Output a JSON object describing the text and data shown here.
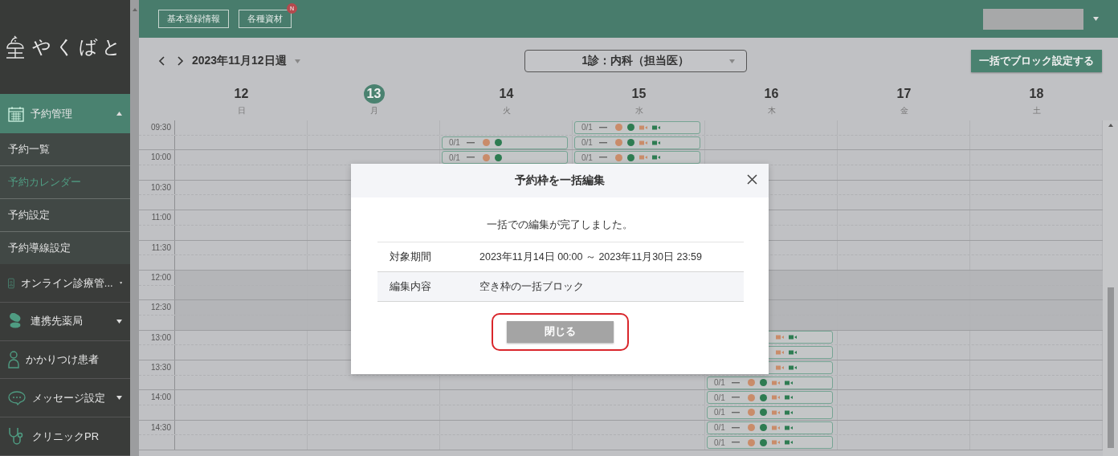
{
  "sidebar": {
    "logo": "やくばと",
    "groups": [
      {
        "label": "予約管理",
        "kind": "menu",
        "selected": true,
        "expanded": true,
        "children": [
          {
            "label": "予約一覧",
            "selected": false
          },
          {
            "label": "予約カレンダー",
            "selected": true
          },
          {
            "label": "予約設定",
            "selected": false
          },
          {
            "label": "予約導線設定",
            "selected": false
          }
        ]
      },
      {
        "label": "オンライン診療管...",
        "kind": "menu",
        "selected": false,
        "expanded": false
      },
      {
        "label": "連携先薬局",
        "kind": "menu",
        "selected": false,
        "expanded": false
      },
      {
        "label": "かかりつけ患者",
        "kind": "link",
        "selected": false
      },
      {
        "label": "メッセージ設定",
        "kind": "menu",
        "selected": false,
        "expanded": false
      },
      {
        "label": "クリニックPR",
        "kind": "link",
        "selected": false
      }
    ]
  },
  "topbar": {
    "buttons": [
      {
        "label": "基本登録情報"
      },
      {
        "label": "各種資材",
        "badge": "N"
      }
    ]
  },
  "toolbar": {
    "week": "2023年11月12日週",
    "department": "1診：内科（担当医）",
    "block_button": "一括でブロック設定する"
  },
  "days": [
    {
      "date": "12",
      "weekday": "日",
      "today": false
    },
    {
      "date": "13",
      "weekday": "月",
      "today": true
    },
    {
      "date": "14",
      "weekday": "火",
      "today": false
    },
    {
      "date": "15",
      "weekday": "水",
      "today": false
    },
    {
      "date": "16",
      "weekday": "木",
      "today": false
    },
    {
      "date": "17",
      "weekday": "金",
      "today": false
    },
    {
      "date": "18",
      "weekday": "土",
      "today": false
    }
  ],
  "rows": [
    {
      "time": "09:30",
      "shaded": false,
      "cells": [
        {
          "kind": "empty"
        },
        {
          "kind": "empty"
        },
        {
          "kind": "empty"
        },
        {
          "kind": "full",
          "count": "0/1"
        },
        {
          "kind": "empty"
        },
        {
          "kind": "empty"
        },
        {
          "kind": "empty"
        }
      ]
    },
    {
      "shaded": false,
      "cells": [
        {
          "kind": "empty"
        },
        {
          "kind": "empty"
        },
        {
          "kind": "dots",
          "count": "0/1"
        },
        {
          "kind": "full",
          "count": "0/1"
        },
        {
          "kind": "empty"
        },
        {
          "kind": "empty"
        },
        {
          "kind": "empty"
        }
      ]
    },
    {
      "time": "10:00",
      "shaded": false,
      "cells": [
        {
          "kind": "empty"
        },
        {
          "kind": "empty"
        },
        {
          "kind": "dots",
          "count": "0/1"
        },
        {
          "kind": "full",
          "count": "0/1"
        },
        {
          "kind": "empty"
        },
        {
          "kind": "empty"
        },
        {
          "kind": "empty"
        }
      ]
    },
    {
      "shaded": false,
      "cells": [
        {
          "kind": "empty"
        },
        {
          "kind": "empty"
        },
        {
          "kind": "empty"
        },
        {
          "kind": "empty"
        },
        {
          "kind": "empty"
        },
        {
          "kind": "empty"
        },
        {
          "kind": "empty"
        }
      ]
    },
    {
      "time": "10:30",
      "shaded": false,
      "cells": [
        {
          "kind": "empty"
        },
        {
          "kind": "empty"
        },
        {
          "kind": "empty"
        },
        {
          "kind": "empty"
        },
        {
          "kind": "empty"
        },
        {
          "kind": "empty"
        },
        {
          "kind": "empty"
        }
      ]
    },
    {
      "shaded": false,
      "cells": [
        {
          "kind": "empty"
        },
        {
          "kind": "empty"
        },
        {
          "kind": "empty"
        },
        {
          "kind": "empty"
        },
        {
          "kind": "empty"
        },
        {
          "kind": "empty"
        },
        {
          "kind": "empty"
        }
      ]
    },
    {
      "time": "11:00",
      "shaded": false,
      "cells": [
        {
          "kind": "empty"
        },
        {
          "kind": "empty"
        },
        {
          "kind": "empty"
        },
        {
          "kind": "empty"
        },
        {
          "kind": "empty"
        },
        {
          "kind": "empty"
        },
        {
          "kind": "empty"
        }
      ]
    },
    {
      "shaded": false,
      "cells": [
        {
          "kind": "empty"
        },
        {
          "kind": "empty"
        },
        {
          "kind": "empty"
        },
        {
          "kind": "empty"
        },
        {
          "kind": "empty"
        },
        {
          "kind": "empty"
        },
        {
          "kind": "empty"
        }
      ]
    },
    {
      "time": "11:30",
      "shaded": false,
      "cells": [
        {
          "kind": "empty"
        },
        {
          "kind": "empty"
        },
        {
          "kind": "empty"
        },
        {
          "kind": "empty"
        },
        {
          "kind": "empty"
        },
        {
          "kind": "empty"
        },
        {
          "kind": "empty"
        }
      ]
    },
    {
      "shaded": false,
      "cells": [
        {
          "kind": "empty"
        },
        {
          "kind": "empty"
        },
        {
          "kind": "empty"
        },
        {
          "kind": "empty"
        },
        {
          "kind": "empty"
        },
        {
          "kind": "empty"
        },
        {
          "kind": "empty"
        }
      ]
    },
    {
      "time": "12:00",
      "shaded": true,
      "cells": [
        {
          "kind": "empty"
        },
        {
          "kind": "empty"
        },
        {
          "kind": "empty"
        },
        {
          "kind": "empty"
        },
        {
          "kind": "empty"
        },
        {
          "kind": "empty"
        },
        {
          "kind": "empty"
        }
      ]
    },
    {
      "shaded": true,
      "cells": [
        {
          "kind": "empty"
        },
        {
          "kind": "empty"
        },
        {
          "kind": "empty"
        },
        {
          "kind": "empty"
        },
        {
          "kind": "empty"
        },
        {
          "kind": "empty"
        },
        {
          "kind": "empty"
        }
      ]
    },
    {
      "time": "12:30",
      "shaded": true,
      "cells": [
        {
          "kind": "empty"
        },
        {
          "kind": "empty"
        },
        {
          "kind": "empty"
        },
        {
          "kind": "empty"
        },
        {
          "kind": "empty"
        },
        {
          "kind": "empty"
        },
        {
          "kind": "empty"
        }
      ]
    },
    {
      "shaded": true,
      "cells": [
        {
          "kind": "empty"
        },
        {
          "kind": "empty"
        },
        {
          "kind": "empty"
        },
        {
          "kind": "empty"
        },
        {
          "kind": "empty"
        },
        {
          "kind": "empty"
        },
        {
          "kind": "empty"
        }
      ]
    },
    {
      "time": "13:00",
      "shaded": false,
      "cells": [
        {
          "kind": "empty"
        },
        {
          "kind": "empty"
        },
        {
          "kind": "empty"
        },
        {
          "kind": "empty"
        },
        {
          "kind": "cams"
        },
        {
          "kind": "empty"
        },
        {
          "kind": "empty"
        }
      ]
    },
    {
      "shaded": false,
      "cells": [
        {
          "kind": "empty"
        },
        {
          "kind": "empty"
        },
        {
          "kind": "empty"
        },
        {
          "kind": "empty"
        },
        {
          "kind": "cams"
        },
        {
          "kind": "empty"
        },
        {
          "kind": "empty"
        }
      ]
    },
    {
      "time": "13:30",
      "shaded": false,
      "cells": [
        {
          "kind": "empty"
        },
        {
          "kind": "empty"
        },
        {
          "kind": "empty"
        },
        {
          "kind": "empty"
        },
        {
          "kind": "cams"
        },
        {
          "kind": "empty"
        },
        {
          "kind": "empty"
        }
      ]
    },
    {
      "shaded": false,
      "cells": [
        {
          "kind": "empty"
        },
        {
          "kind": "empty"
        },
        {
          "kind": "empty"
        },
        {
          "kind": "empty"
        },
        {
          "kind": "full",
          "count": "0/1"
        },
        {
          "kind": "empty"
        },
        {
          "kind": "empty"
        }
      ]
    },
    {
      "time": "14:00",
      "shaded": false,
      "cells": [
        {
          "kind": "empty"
        },
        {
          "kind": "empty"
        },
        {
          "kind": "empty"
        },
        {
          "kind": "empty"
        },
        {
          "kind": "full",
          "count": "0/1"
        },
        {
          "kind": "empty"
        },
        {
          "kind": "empty"
        }
      ]
    },
    {
      "shaded": false,
      "cells": [
        {
          "kind": "empty"
        },
        {
          "kind": "empty"
        },
        {
          "kind": "empty"
        },
        {
          "kind": "empty"
        },
        {
          "kind": "full",
          "count": "0/1"
        },
        {
          "kind": "empty"
        },
        {
          "kind": "empty"
        }
      ]
    },
    {
      "time": "14:30",
      "shaded": false,
      "cells": [
        {
          "kind": "empty"
        },
        {
          "kind": "empty"
        },
        {
          "kind": "empty"
        },
        {
          "kind": "empty"
        },
        {
          "kind": "full",
          "count": "0/1"
        },
        {
          "kind": "empty"
        },
        {
          "kind": "empty"
        }
      ]
    },
    {
      "shaded": false,
      "cells": [
        {
          "kind": "empty"
        },
        {
          "kind": "empty"
        },
        {
          "kind": "empty"
        },
        {
          "kind": "empty"
        },
        {
          "kind": "full",
          "count": "0/1"
        },
        {
          "kind": "empty"
        },
        {
          "kind": "empty"
        }
      ]
    }
  ],
  "modal": {
    "title": "予約枠を一括編集",
    "message": "一括での編集が完了しました。",
    "rows": [
      {
        "label": "対象期間",
        "value": "2023年11月14日 00:00 ～ 2023年11月30日 23:59"
      },
      {
        "label": "編集内容",
        "value": "空き枠の一括ブロック"
      }
    ],
    "close_button": "閉じる",
    "highlighted": true
  }
}
